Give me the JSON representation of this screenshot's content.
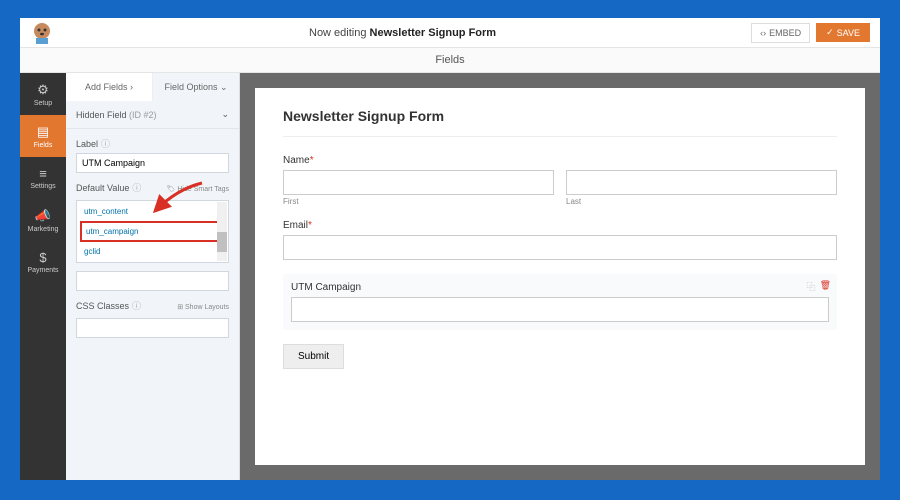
{
  "topbar": {
    "editing_prefix": "Now editing",
    "form_name": "Newsletter Signup Form",
    "embed": "EMBED",
    "save": "SAVE"
  },
  "fields_tab": "Fields",
  "sidebar": [
    {
      "label": "Setup"
    },
    {
      "label": "Fields"
    },
    {
      "label": "Settings"
    },
    {
      "label": "Marketing"
    },
    {
      "label": "Payments"
    }
  ],
  "panel": {
    "tab_add": "Add Fields ›",
    "tab_opts": "Field Options ⌄",
    "hidden_field": "Hidden Field",
    "hidden_id": "(ID #2)",
    "label_lbl": "Label",
    "label_val": "UTM Campaign",
    "default_lbl": "Default Value",
    "hide_tags": "🏷 Hide Smart Tags",
    "tags": [
      "utm_content",
      "utm_campaign",
      "gclid"
    ],
    "css_lbl": "CSS Classes",
    "show_layouts": "⊞ Show Layouts"
  },
  "form": {
    "title": "Newsletter Signup Form",
    "name_lbl": "Name",
    "first": "First",
    "last": "Last",
    "email_lbl": "Email",
    "utm_lbl": "UTM Campaign",
    "submit": "Submit"
  }
}
